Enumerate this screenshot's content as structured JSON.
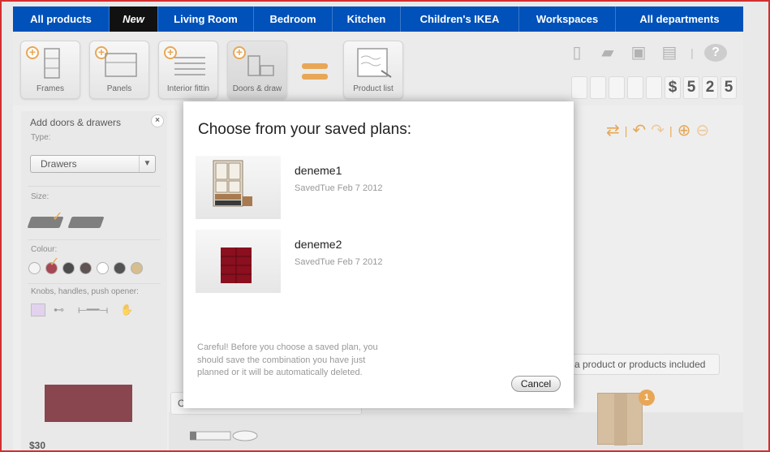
{
  "nav": {
    "items": [
      {
        "label": "All products"
      },
      {
        "label": "New"
      },
      {
        "label": "Living Room"
      },
      {
        "label": "Bedroom"
      },
      {
        "label": "Kitchen"
      },
      {
        "label": "Children's IKEA"
      },
      {
        "label": "Workspaces"
      },
      {
        "label": "All departments"
      }
    ]
  },
  "toolbar": {
    "tools": [
      {
        "label": "Frames",
        "icon": "frames-icon"
      },
      {
        "label": "Panels",
        "icon": "panels-icon"
      },
      {
        "label": "Interior fittin",
        "icon": "interior-fittings-icon"
      },
      {
        "label": "Doors & draw",
        "icon": "doors-drawers-icon"
      }
    ],
    "product_list_label": "Product list",
    "price_digits": [
      "",
      "",
      "",
      "",
      "",
      "$",
      "5",
      "2",
      "5"
    ],
    "help_label": "?"
  },
  "left_panel": {
    "title": "Add doors & drawers",
    "close_label": "×",
    "type_label": "Type:",
    "type_value": "Drawers",
    "size_label": "Size:",
    "colour_label": "Colour:",
    "colours": [
      "#f0f0f0",
      "#8a0a1a",
      "#111111",
      "#2a1a1a",
      "#ffffff",
      "#1a1a1a",
      "#c8a96a"
    ],
    "knobs_label": "Knobs, handles, push opener:",
    "price": "$30",
    "preview_color": "#620813"
  },
  "scene": {
    "tooltip_products": "a product or products included",
    "tooltip_left": "C",
    "badge_count": "1",
    "accent": "#e08a1e"
  },
  "modal": {
    "title": "Choose from your saved plans:",
    "plans": [
      {
        "name": "deneme1",
        "date": "SavedTue Feb 7 2012"
      },
      {
        "name": "deneme2",
        "date": "SavedTue Feb 7 2012"
      }
    ],
    "note": "Careful! Before you choose a saved plan, you should save the combination you have just planned or it will be automatically deleted.",
    "cancel_label": "Cancel"
  }
}
